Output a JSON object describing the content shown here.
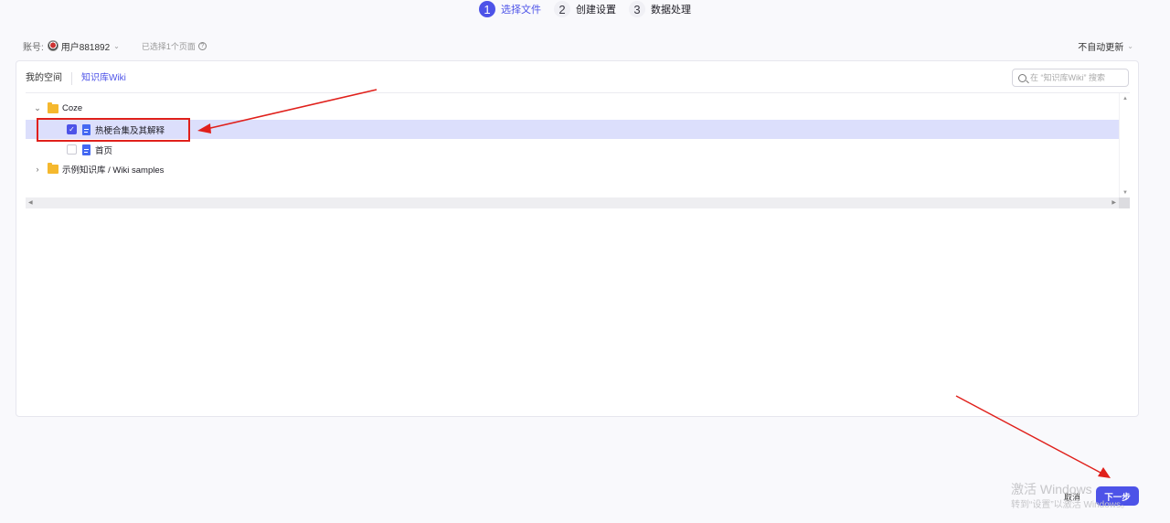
{
  "stepper": {
    "steps": [
      {
        "num": "1",
        "label": "选择文件"
      },
      {
        "num": "2",
        "label": "创建设置"
      },
      {
        "num": "3",
        "label": "数据处理"
      }
    ]
  },
  "account": {
    "label": "账号:",
    "user": "用户881892",
    "selected_info": "已选择1个页面",
    "auto_update": "不自动更新"
  },
  "tabs": [
    "我的空间",
    "知识库Wiki"
  ],
  "search": {
    "placeholder": "在 “知识库Wiki” 搜索"
  },
  "tree": {
    "items": [
      {
        "label": "Coze",
        "type": "folder",
        "expanded": true
      },
      {
        "label": "热梗合集及其解释",
        "type": "doc",
        "checked": true
      },
      {
        "label": "首页",
        "type": "doc",
        "checked": false
      },
      {
        "label": "示例知识库 / Wiki samples",
        "type": "folder",
        "expanded": false
      }
    ]
  },
  "footer": {
    "cancel_label": "取消",
    "next_label": "下一步"
  },
  "watermark": {
    "title": "激活 Windows",
    "subtitle": "转到“设置”以激活 Windows。"
  },
  "colors": {
    "accent": "#4d53e8",
    "annotation": "#e0201b",
    "folder": "#f5b82e",
    "doc": "#4468f2",
    "selected_row": "#dcdffc"
  },
  "icons": [
    "info-icon",
    "search-icon",
    "folder-icon",
    "document-icon",
    "chevron-down-icon",
    "chevron-right-icon",
    "check-icon"
  ]
}
